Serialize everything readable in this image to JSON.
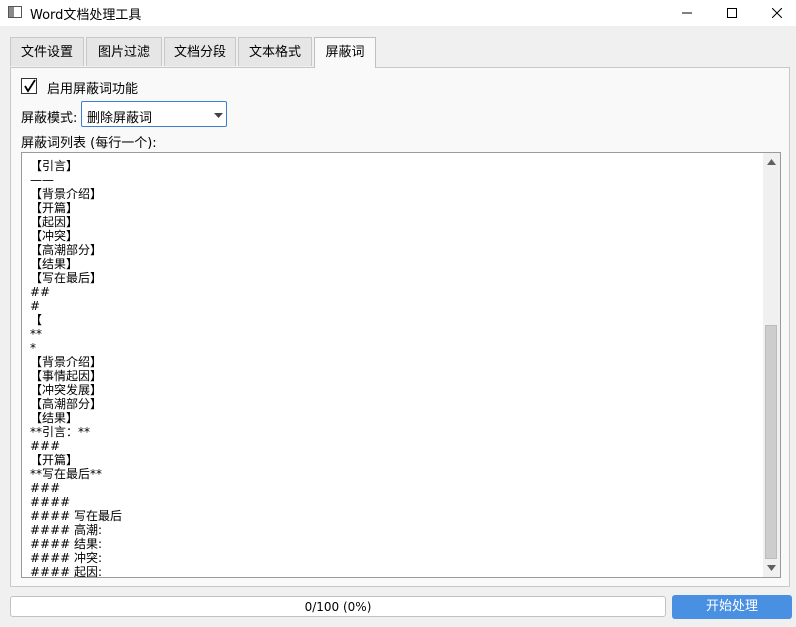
{
  "window": {
    "title": "Word文档处理工具",
    "icon": "app-window-icon"
  },
  "tabs": [
    {
      "label": "文件设置",
      "active": false
    },
    {
      "label": "图片过滤",
      "active": false
    },
    {
      "label": "文档分段",
      "active": false
    },
    {
      "label": "文本格式",
      "active": false
    },
    {
      "label": "屏蔽词",
      "active": true
    }
  ],
  "block_words": {
    "enable_label": "启用屏蔽词功能",
    "enabled": true,
    "mode_label": "屏蔽模式:",
    "mode_value": "删除屏蔽词",
    "list_label": "屏蔽词列表 (每行一个):",
    "list_text": "【引言】\n——\n【背景介绍】\n【开篇】\n【起因】\n【冲突】\n【高潮部分】\n【结果】\n【写在最后】\n##\n#\n【\n**\n*\n【背景介绍】\n【事情起因】\n【冲突发展】\n【高潮部分】\n【结果】\n**引言：**\n###\n【开篇】\n**写在最后**\n###\n####\n#### 写在最后\n#### 高潮:\n#### 结果:\n#### 冲突:\n#### 起因:"
  },
  "progress": {
    "text": "0/100 (0%)",
    "value": 0
  },
  "start_button": {
    "label": "开始处理"
  },
  "colors": {
    "accent": "#4a90e2",
    "background": "#f0f0f0"
  }
}
